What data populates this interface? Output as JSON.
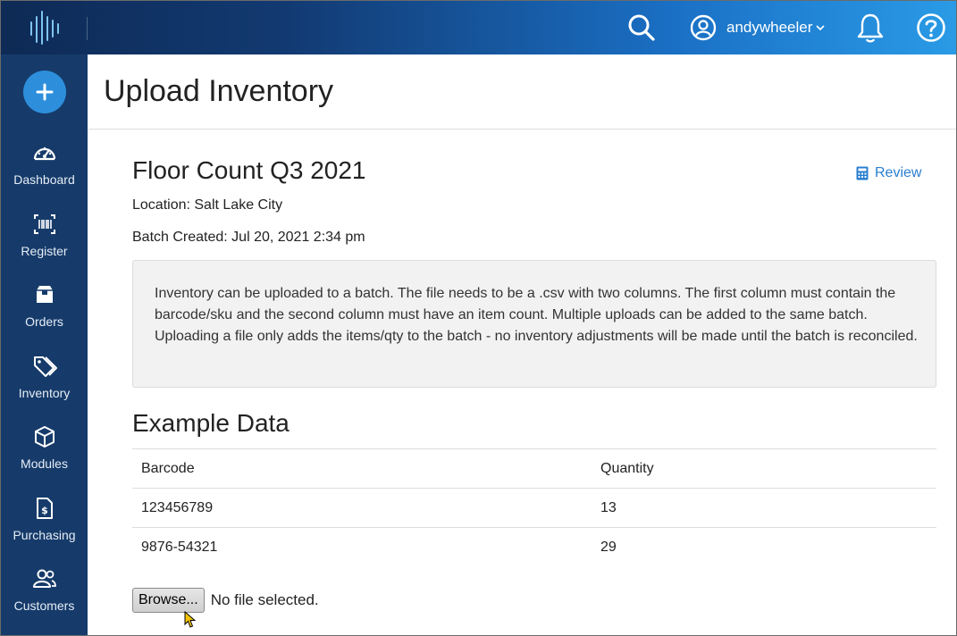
{
  "topbar": {
    "username": "andywheeler"
  },
  "sidebar": {
    "items": [
      {
        "label": "Dashboard",
        "icon": "dashboard-icon"
      },
      {
        "label": "Register",
        "icon": "barcode-icon"
      },
      {
        "label": "Orders",
        "icon": "box-icon"
      },
      {
        "label": "Inventory",
        "icon": "tags-icon"
      },
      {
        "label": "Modules",
        "icon": "cube-icon"
      },
      {
        "label": "Purchasing",
        "icon": "invoice-icon"
      },
      {
        "label": "Customers",
        "icon": "users-icon"
      }
    ]
  },
  "page": {
    "title": "Upload Inventory"
  },
  "batch": {
    "title": "Floor Count Q3 2021",
    "review_label": "Review",
    "location": "Location: Salt Lake City",
    "created": "Batch Created: Jul 20, 2021 2:34 pm",
    "info": "Inventory can be uploaded to a batch. The file needs to be a .csv with two columns. The first column must contain the barcode/sku and the second column must have an item count. Multiple uploads can be added to the same batch. Uploading a file only adds the items/qty to the batch - no inventory adjustments will be made until the batch is reconciled."
  },
  "example": {
    "title": "Example Data",
    "headers": [
      "Barcode",
      "Quantity"
    ],
    "rows": [
      [
        "123456789",
        "13"
      ],
      [
        "9876-54321",
        "29"
      ]
    ]
  },
  "upload": {
    "browse_label": "Browse...",
    "status": "No file selected."
  },
  "colors": {
    "sidebar": "#163b6a",
    "accent": "#2a7fcf",
    "add_button": "#2d8fdc"
  }
}
